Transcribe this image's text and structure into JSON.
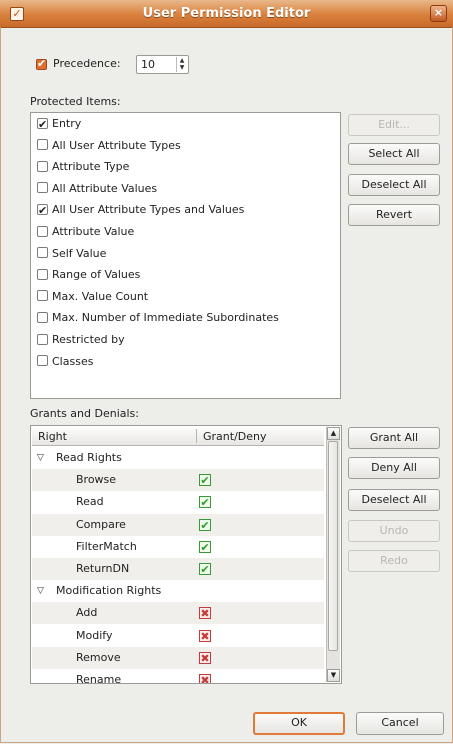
{
  "window": {
    "title": "User Permission Editor",
    "close_glyph": "×"
  },
  "precedence": {
    "label": "Precedence:",
    "value": "10",
    "checked": true
  },
  "protected_items": {
    "label": "Protected Items:",
    "items": [
      {
        "label": "Entry",
        "checked": true
      },
      {
        "label": "All User Attribute Types",
        "checked": false
      },
      {
        "label": "Attribute Type",
        "checked": false
      },
      {
        "label": "All Attribute Values",
        "checked": false
      },
      {
        "label": "All User Attribute Types and Values",
        "checked": true
      },
      {
        "label": "Attribute Value",
        "checked": false
      },
      {
        "label": "Self Value",
        "checked": false
      },
      {
        "label": "Range of Values",
        "checked": false
      },
      {
        "label": "Max. Value Count",
        "checked": false
      },
      {
        "label": "Max. Number of Immediate Subordinates",
        "checked": false
      },
      {
        "label": "Restricted by",
        "checked": false
      },
      {
        "label": "Classes",
        "checked": false
      }
    ],
    "buttons": {
      "edit": "Edit...",
      "select_all": "Select All",
      "deselect_all": "Deselect All",
      "revert": "Revert"
    }
  },
  "grants": {
    "label": "Grants and Denials:",
    "columns": {
      "right": "Right",
      "grant_deny": "Grant/Deny"
    },
    "rows": [
      {
        "type": "group",
        "label": "Read Rights"
      },
      {
        "type": "item",
        "label": "Browse",
        "state": "grant"
      },
      {
        "type": "item",
        "label": "Read",
        "state": "grant"
      },
      {
        "type": "item",
        "label": "Compare",
        "state": "grant"
      },
      {
        "type": "item",
        "label": "FilterMatch",
        "state": "grant"
      },
      {
        "type": "item",
        "label": "ReturnDN",
        "state": "grant"
      },
      {
        "type": "group",
        "label": "Modification Rights"
      },
      {
        "type": "item",
        "label": "Add",
        "state": "deny"
      },
      {
        "type": "item",
        "label": "Modify",
        "state": "deny"
      },
      {
        "type": "item",
        "label": "Remove",
        "state": "deny"
      },
      {
        "type": "item",
        "label": "Rename",
        "state": "deny"
      }
    ],
    "buttons": {
      "grant_all": "Grant All",
      "deny_all": "Deny All",
      "deselect_all": "Deselect All",
      "undo": "Undo",
      "redo": "Redo"
    }
  },
  "footer": {
    "ok": "OK",
    "cancel": "Cancel"
  },
  "colors": {
    "accent": "#d9803c",
    "grant": "#2f9a2f",
    "deny": "#c43b3b"
  }
}
